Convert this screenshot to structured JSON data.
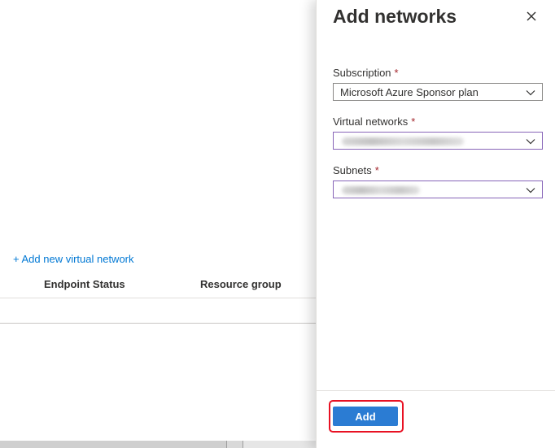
{
  "background_page": {
    "add_link": "+ Add new virtual network",
    "columns": [
      "Endpoint Status",
      "Resource group"
    ]
  },
  "panel": {
    "title": "Add networks",
    "close_icon": "close-icon",
    "fields": [
      {
        "label": "Subscription",
        "required_mark": "*",
        "value": "Microsoft Azure Sponsor plan"
      },
      {
        "label": "Virtual networks",
        "required_mark": "*",
        "value": ""
      },
      {
        "label": "Subnets",
        "required_mark": "*",
        "value": ""
      }
    ],
    "add_label": "Add"
  },
  "colors": {
    "accent": "#2b7cd3",
    "link": "#0078d4",
    "required": "#a4262c",
    "focus_border": "#8764b8",
    "highlight": "#e81123"
  }
}
